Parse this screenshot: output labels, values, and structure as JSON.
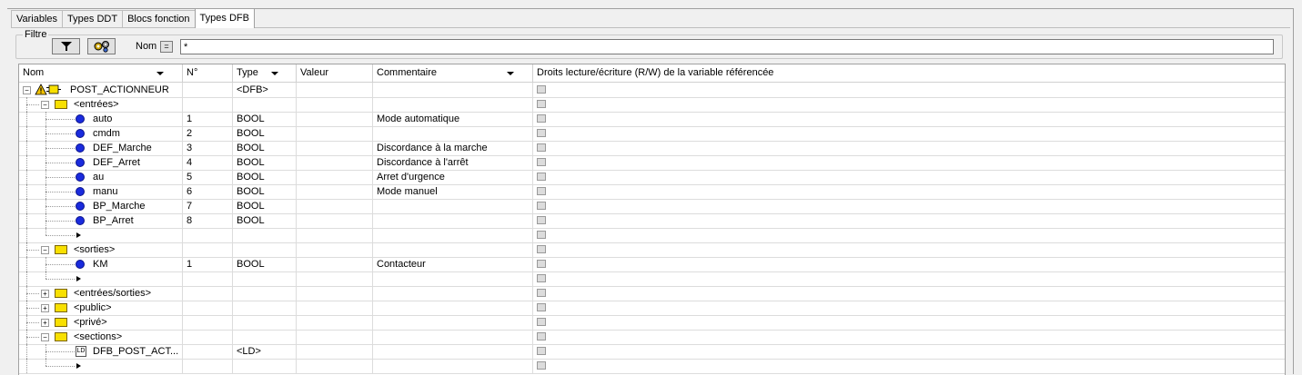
{
  "tabs": [
    {
      "label": "Variables"
    },
    {
      "label": "Types DDT"
    },
    {
      "label": "Blocs fonction"
    },
    {
      "label": "Types DFB",
      "active": true
    }
  ],
  "filter": {
    "legend": "Filtre",
    "name_label": "Nom",
    "eq_label": "=",
    "value": "*"
  },
  "columns": [
    {
      "label": "Nom",
      "sortable": true
    },
    {
      "label": "N°",
      "sortable": false
    },
    {
      "label": "Type",
      "sortable": true
    },
    {
      "label": "Valeur",
      "sortable": false
    },
    {
      "label": "Commentaire",
      "sortable": true
    },
    {
      "label": "Droits lecture/écriture (R/W) de la variable référencée",
      "sortable": false
    }
  ],
  "rows": [
    {
      "kind": "dfb",
      "name": "POST_ACTIONNEUR",
      "num": "",
      "type": "<DFB>",
      "comment": ""
    },
    {
      "kind": "group-open",
      "name": "<entrées>",
      "num": "",
      "type": "",
      "comment": ""
    },
    {
      "kind": "var",
      "name": "auto",
      "num": "1",
      "type": "BOOL",
      "comment": "Mode automatique"
    },
    {
      "kind": "var",
      "name": "cmdm",
      "num": "2",
      "type": "BOOL",
      "comment": ""
    },
    {
      "kind": "var",
      "name": "DEF_Marche",
      "num": "3",
      "type": "BOOL",
      "comment": "Discordance à la marche"
    },
    {
      "kind": "var",
      "name": "DEF_Arret",
      "num": "4",
      "type": "BOOL",
      "comment": "Discordance à l'arrêt"
    },
    {
      "kind": "var",
      "name": "au",
      "num": "5",
      "type": "BOOL",
      "comment": "Arret d'urgence"
    },
    {
      "kind": "var",
      "name": "manu",
      "num": "6",
      "type": "BOOL",
      "comment": "Mode manuel"
    },
    {
      "kind": "var",
      "name": "BP_Marche",
      "num": "7",
      "type": "BOOL",
      "comment": ""
    },
    {
      "kind": "var",
      "name": "BP_Arret",
      "num": "8",
      "type": "BOOL",
      "comment": ""
    },
    {
      "kind": "new",
      "name": "",
      "num": "",
      "type": "",
      "comment": ""
    },
    {
      "kind": "group-open",
      "name": "<sorties>",
      "num": "",
      "type": "",
      "comment": ""
    },
    {
      "kind": "var",
      "name": "KM",
      "num": "1",
      "type": "BOOL",
      "comment": "Contacteur"
    },
    {
      "kind": "new",
      "name": "",
      "num": "",
      "type": "",
      "comment": ""
    },
    {
      "kind": "group-closed",
      "name": "<entrées/sorties>",
      "num": "",
      "type": "",
      "comment": ""
    },
    {
      "kind": "group-closed",
      "name": "<public>",
      "num": "",
      "type": "",
      "comment": ""
    },
    {
      "kind": "group-closed",
      "name": "<privé>",
      "num": "",
      "type": "",
      "comment": ""
    },
    {
      "kind": "group-open",
      "name": "<sections>",
      "num": "",
      "type": "",
      "comment": ""
    },
    {
      "kind": "section",
      "name": "DFB_POST_ACT...",
      "num": "",
      "type": "<LD>",
      "comment": ""
    },
    {
      "kind": "new",
      "name": "",
      "num": "",
      "type": "",
      "comment": ""
    }
  ]
}
